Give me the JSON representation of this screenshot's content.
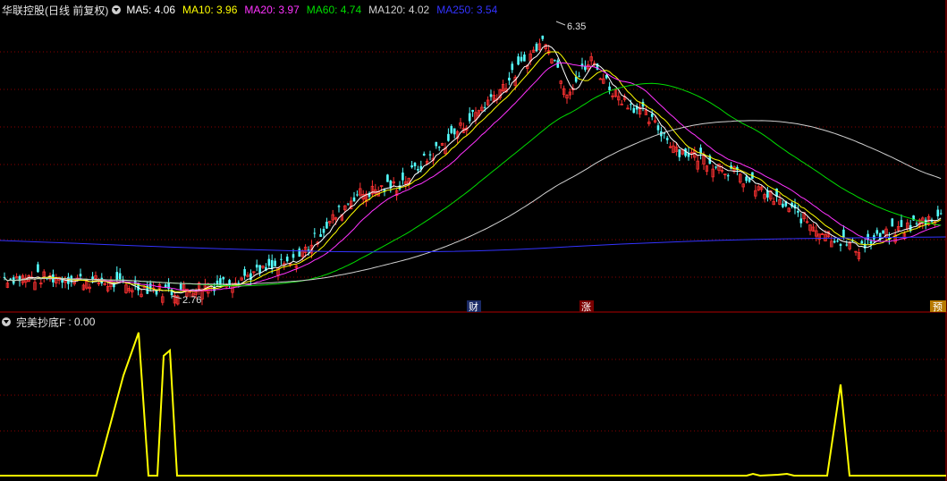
{
  "header": {
    "title": "华联控股(日线 前复权)",
    "ma": [
      {
        "label": "MA5: 4.06",
        "color": "#ffffff"
      },
      {
        "label": "MA10: 3.96",
        "color": "#ffff00"
      },
      {
        "label": "MA20: 3.97",
        "color": "#ff33ff"
      },
      {
        "label": "MA60: 4.74",
        "color": "#00dd00"
      },
      {
        "label": "MA120: 4.02",
        "color": "#d0d0d0"
      },
      {
        "label": "MA250: 3.54",
        "color": "#3333ff"
      }
    ]
  },
  "price_chart": {
    "high_label": "6.35",
    "low_label": "2.76",
    "markers": [
      "财",
      "涨",
      "预"
    ]
  },
  "indicator": {
    "title": "完美抄底F",
    "value_label": ": 0.00"
  },
  "colors": {
    "up": "#ff3232",
    "down": "#54ffff",
    "grid": "#8b0000",
    "ma5": "#ffffff",
    "ma10": "#ffff00",
    "ma20": "#ff33ff",
    "ma60": "#00dd00",
    "ma120": "#d0d0d0",
    "ma250": "#3333ff",
    "indicator_line": "#ffff00"
  }
}
